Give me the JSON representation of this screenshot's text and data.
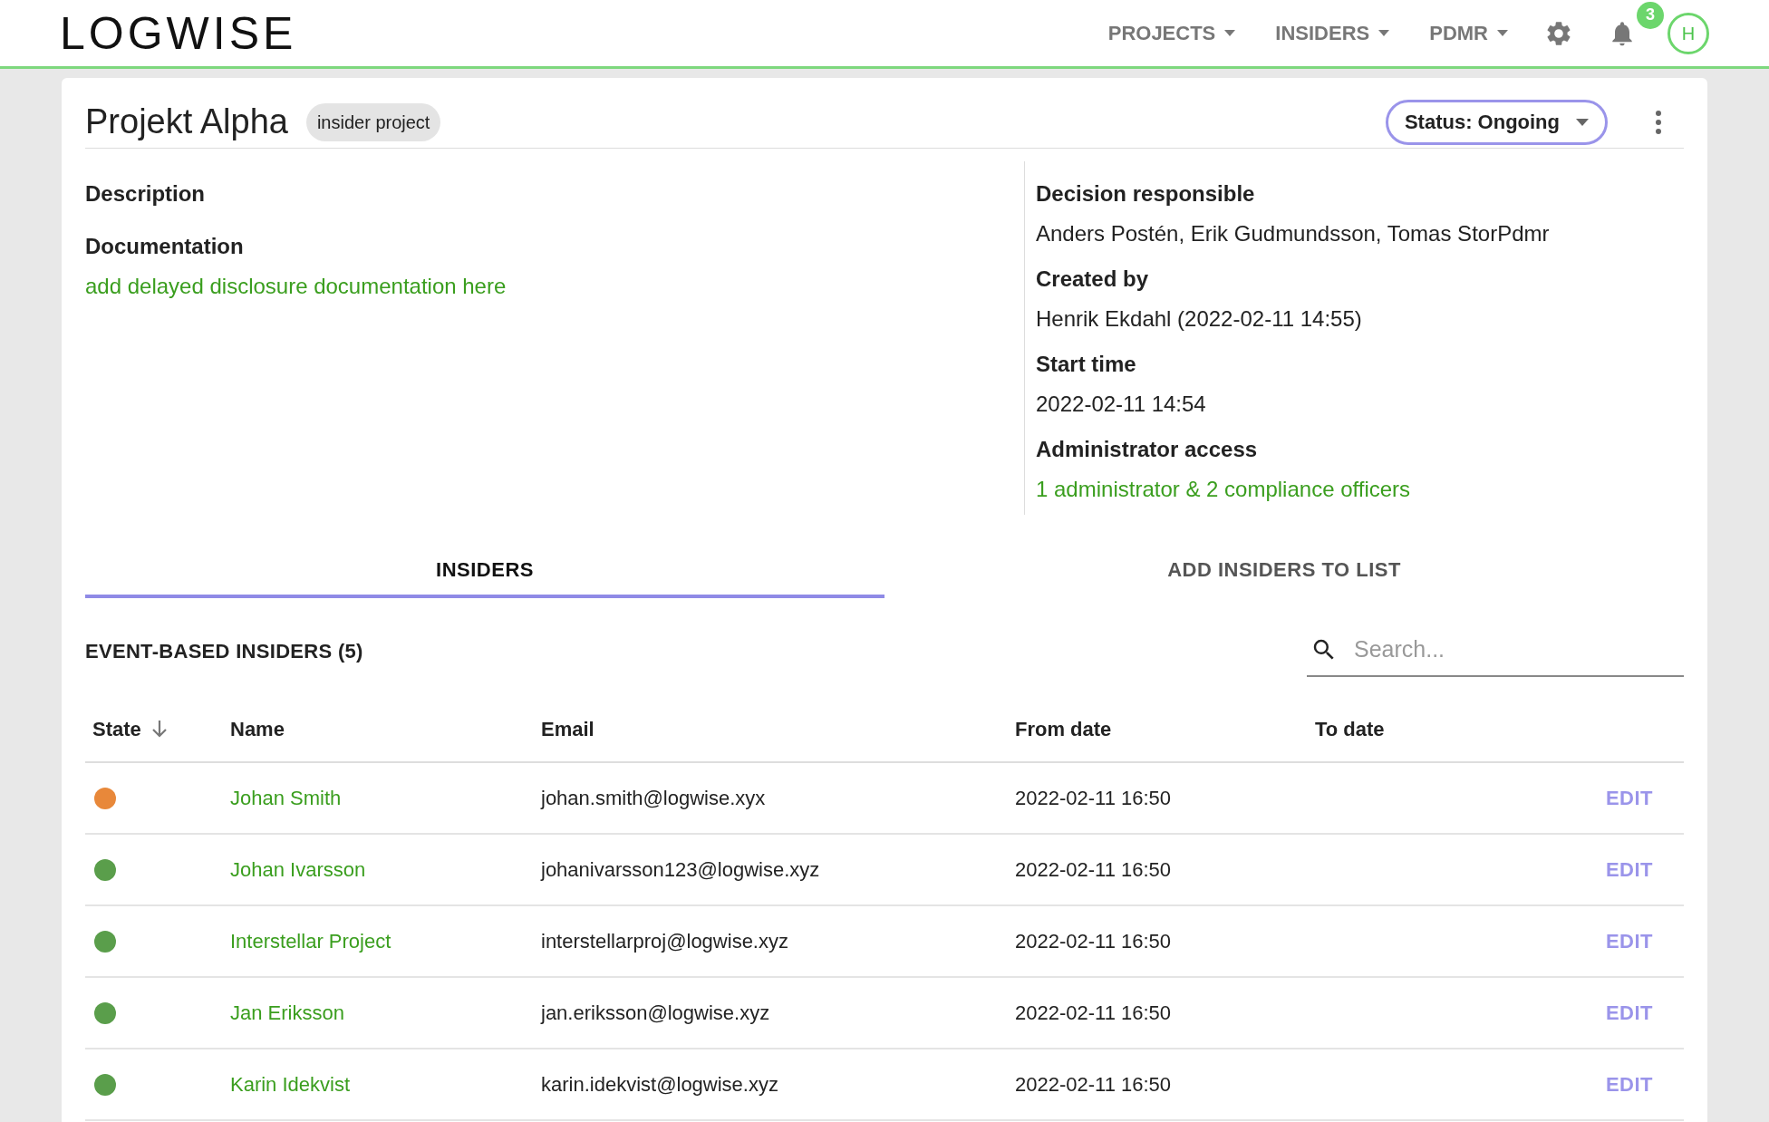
{
  "header": {
    "logo": "LOGWISE",
    "nav": [
      "PROJECTS",
      "INSIDERS",
      "PDMR"
    ],
    "notifications": "3",
    "avatar": "H"
  },
  "project": {
    "title": "Projekt Alpha",
    "badge": "insider project",
    "status": "Status: Ongoing"
  },
  "details_left": [
    {
      "label": "Description"
    },
    {
      "label": "Documentation",
      "link": "add delayed disclosure documentation here"
    }
  ],
  "details_right": [
    {
      "label": "Decision responsible",
      "value": "Anders Postén, Erik Gudmundsson, Tomas StorPdmr"
    },
    {
      "label": "Created by",
      "value": "Henrik Ekdahl (2022-02-11 14:55)"
    },
    {
      "label": "Start time",
      "value": "2022-02-11 14:54"
    },
    {
      "label": "Administrator access",
      "link": "1 administrator & 2 compliance officers"
    }
  ],
  "tabs": [
    {
      "label": "INSIDERS",
      "selected": true
    },
    {
      "label": "ADD INSIDERS TO LIST",
      "selected": false
    }
  ],
  "section_title": "EVENT-BASED INSIDERS (5)",
  "search": {
    "placeholder": "Search..."
  },
  "table": {
    "columns": [
      "State",
      "Name",
      "Email",
      "From date",
      "To date"
    ],
    "rows": [
      {
        "color": "#e8883a",
        "name": "Johan Smith",
        "email": "johan.smith@logwise.xyx",
        "from": "2022-02-11 16:50",
        "action": "EDIT"
      },
      {
        "color": "#5a9e4b",
        "name": "Johan Ivarsson",
        "email": "johanivarsson123@logwise.xyz",
        "from": "2022-02-11 16:50",
        "action": "EDIT"
      },
      {
        "color": "#5a9e4b",
        "name": "Interstellar Project",
        "email": "interstellarproj@logwise.xyz",
        "from": "2022-02-11 16:50",
        "action": "EDIT"
      },
      {
        "color": "#5a9e4b",
        "name": "Jan Eriksson",
        "email": "jan.eriksson@logwise.xyz",
        "from": "2022-02-11 16:50",
        "action": "EDIT"
      },
      {
        "color": "#5a9e4b",
        "name": "Karin Idekvist",
        "email": "karin.idekvist@logwise.xyz",
        "from": "2022-02-11 16:50",
        "action": "EDIT"
      }
    ]
  }
}
